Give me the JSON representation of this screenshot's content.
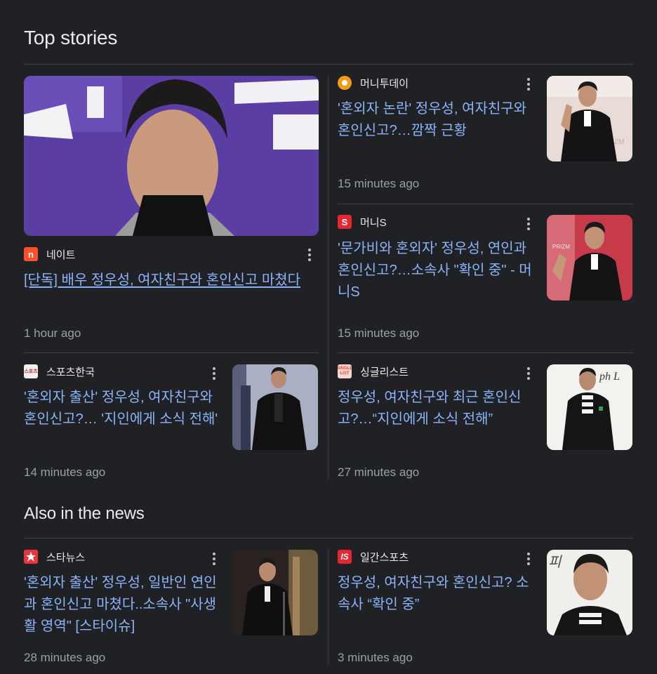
{
  "sections": {
    "top_stories_title": "Top stories",
    "also_in_news_title": "Also in the news"
  },
  "stories": [
    {
      "source": "네이트",
      "headline": "[단독] 배우 정우성, 여자친구와 혼인신고 마쳤다",
      "time": "1 hour ago",
      "logo_text": "n",
      "logo_color": "#ff4f2d"
    },
    {
      "source": "머니투데이",
      "headline": "'혼외자 논란' 정우성, 여자친구와 혼인신고?…깜짝 근황",
      "time": "15 minutes ago",
      "logo_color": "#f39a1a"
    },
    {
      "source": "머니S",
      "headline": "'문가비와 혼외자' 정우성, 연인과 혼인신고?…소속사 \"확인 중\" - 머니S",
      "time": "15 minutes ago",
      "logo_text": "S",
      "logo_color": "#e3262f"
    },
    {
      "source": "스포츠한국",
      "headline": "'혼외자 출산' 정우성, 여자친구와 혼인신고?… '지인에게 소식 전해'",
      "time": "14 minutes ago",
      "logo_text": "스포츠",
      "logo_color": "#f1f1f1"
    },
    {
      "source": "싱글리스트",
      "headline": "정우성, 여자친구와 최근 혼인신고?…“지인에게 소식 전해”",
      "time": "27 minutes ago",
      "logo_text": "SINGLE LIST",
      "logo_color": "#f8d8ce"
    },
    {
      "source": "스타뉴스",
      "headline": "'혼외자 출산' 정우성, 일반인 연인과 혼인신고 마쳤다..소속사 \"사생활 영역\" [스타이슈]",
      "time": "28 minutes ago",
      "logo_color": "#e8343a"
    },
    {
      "source": "일간스포츠",
      "headline": "정우성, 여자친구와 혼인신고? 소속사 “확인 중”",
      "time": "3 minutes ago",
      "logo_text": "IS",
      "logo_color": "#e3262f"
    }
  ],
  "thumb_overlay": {
    "main_sign": "피",
    "side_sign": "ph L",
    "prizm": "PRIZM",
    "zm": "ZM"
  }
}
